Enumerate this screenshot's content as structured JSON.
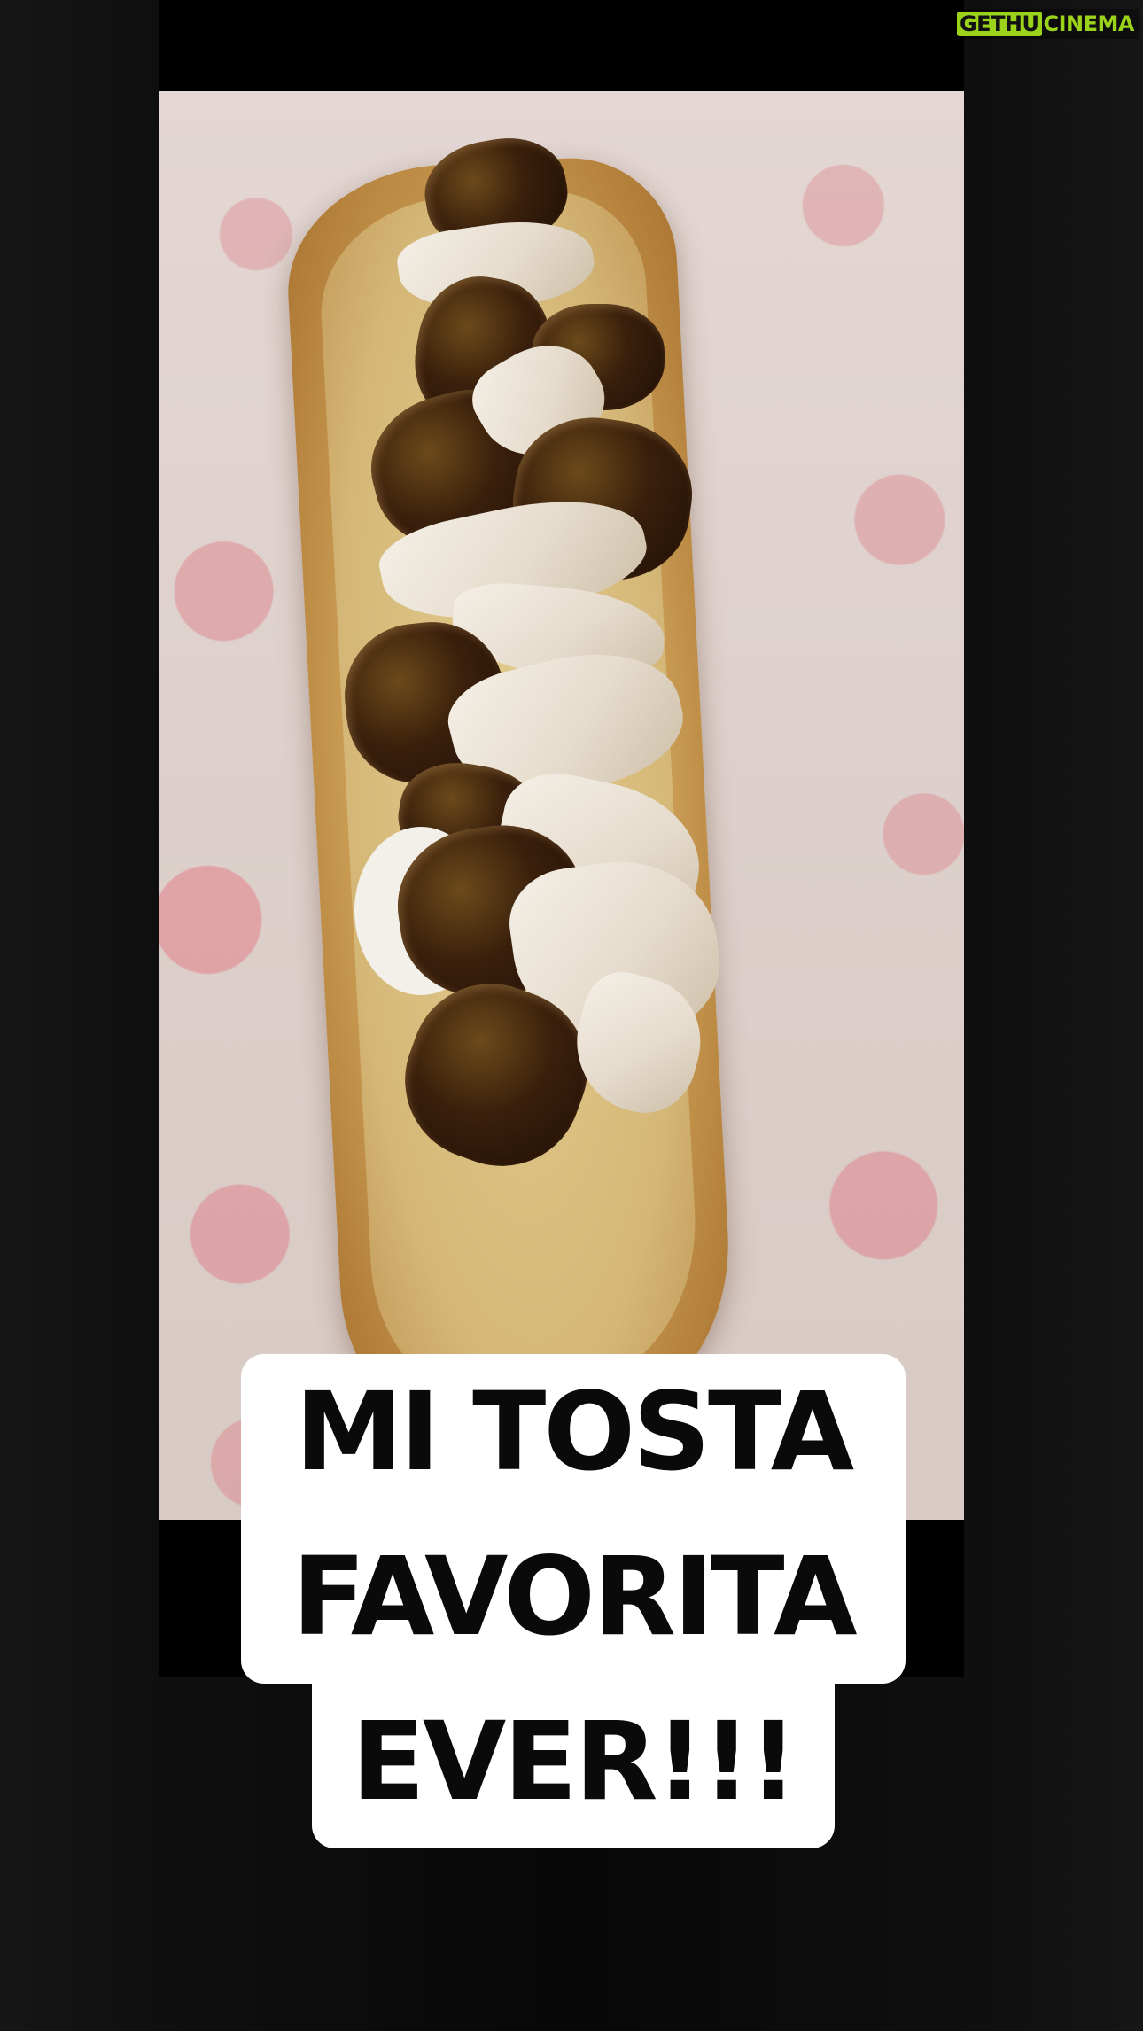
{
  "watermark": {
    "left": "GETHU",
    "right": "CINEMA",
    "accent_color": "#9bd21a"
  },
  "caption": {
    "line1": "MI TOSTA",
    "line2": "FAVORITA",
    "line3": "EVER!!!"
  },
  "media": {
    "description_icon": "photo-video"
  }
}
